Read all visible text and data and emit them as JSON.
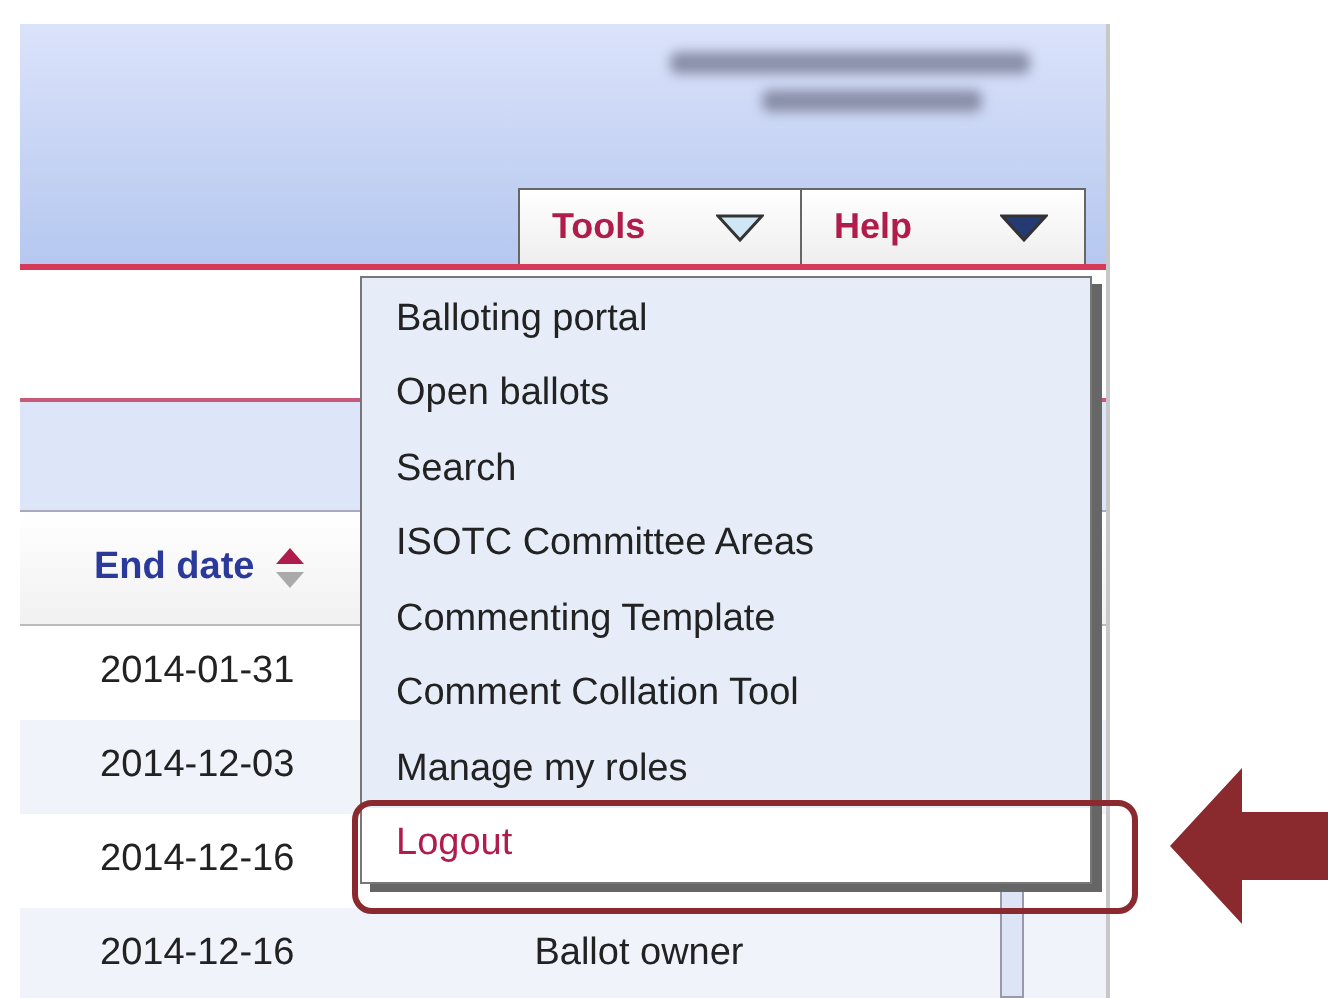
{
  "header": {
    "menu_buttons": [
      {
        "label": "Tools",
        "open": true
      },
      {
        "label": "Help",
        "open": false
      }
    ]
  },
  "table": {
    "columns": [
      {
        "label": "End date",
        "sort_ascending": true
      }
    ],
    "rows": [
      {
        "end_date": "2014-01-31"
      },
      {
        "end_date": "2014-12-03"
      },
      {
        "end_date": "2014-12-16"
      },
      {
        "end_date": "2014-12-16",
        "role": "Ballot owner"
      }
    ]
  },
  "dropdown": {
    "items": [
      {
        "label": "Balloting portal",
        "selected": false,
        "circled": false
      },
      {
        "label": "Open ballots",
        "selected": false,
        "circled": false
      },
      {
        "label": "Search",
        "selected": false,
        "circled": false
      },
      {
        "label": "ISOTC Committee Areas",
        "selected": false,
        "circled": false
      },
      {
        "label": "Commenting Template",
        "selected": false,
        "circled": false
      },
      {
        "label": "Comment Collation Tool",
        "selected": false,
        "circled": false
      },
      {
        "label": "Manage my roles",
        "selected": false,
        "circled": false
      },
      {
        "label": "Logout",
        "selected": true,
        "circled": true
      }
    ]
  }
}
